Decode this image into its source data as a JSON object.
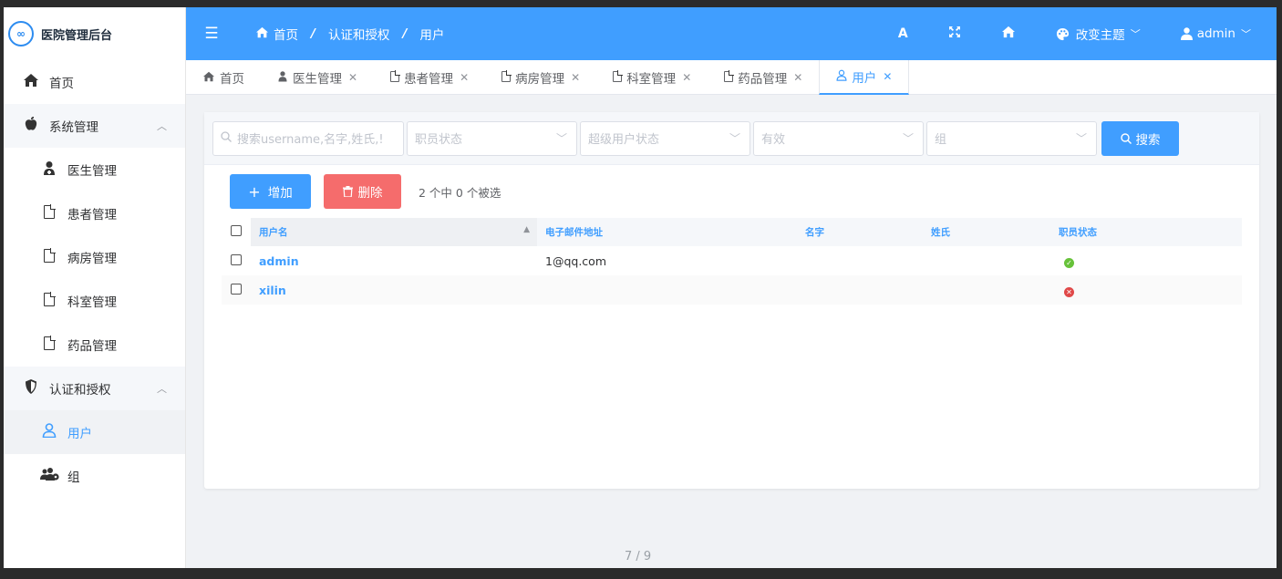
{
  "sidebar": {
    "logo_mark": "∞",
    "title": "医院管理后台",
    "home": "首页",
    "group1": "系统管理",
    "doctor": "医生管理",
    "patient": "患者管理",
    "ward": "病房管理",
    "dept": "科室管理",
    "drug": "药品管理",
    "group2": "认证和授权",
    "user": "用户",
    "team": "组"
  },
  "header": {
    "crumb_home": "首页",
    "crumb_sep": "/",
    "crumb_auth": "认证和授权",
    "crumb_user": "用户",
    "font_btn": "A",
    "theme": "改变主题",
    "admin": "admin"
  },
  "tabs": [
    "首页",
    "医生管理",
    "患者管理",
    "病房管理",
    "科室管理",
    "药品管理",
    "用户"
  ],
  "filters": {
    "search_placeholder": "搜索username,名字,姓氏,!",
    "staff_status": "职员状态",
    "super_status": "超级用户状态",
    "active": "有效",
    "group": "组",
    "search_btn": "搜索"
  },
  "actions": {
    "add": "增加",
    "delete": "删除",
    "selected": "2 个中 0 个被选"
  },
  "table": {
    "columns": [
      "用户名",
      "电子邮件地址",
      "名字",
      "姓氏",
      "职员状态"
    ],
    "rows": [
      {
        "username": "admin",
        "email": "1@qq.com",
        "first": "",
        "last": "",
        "staff": true
      },
      {
        "username": "xilin",
        "email": "",
        "first": "",
        "last": "",
        "staff": false
      }
    ]
  },
  "pager": "7 / 9",
  "colors": {
    "primary": "#409eff",
    "danger": "#f56c6c",
    "success": "#67c23a"
  }
}
